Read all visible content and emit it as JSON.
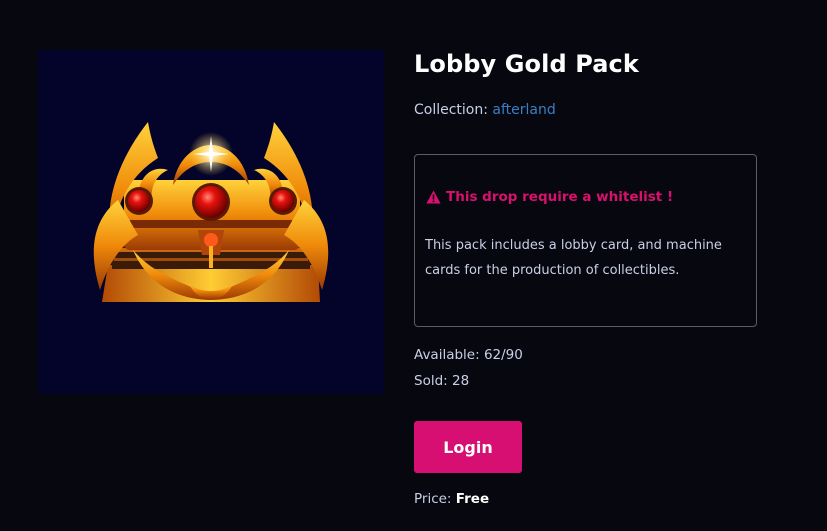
{
  "product": {
    "title": "Lobby Gold Pack",
    "image_alt": "golden treasure chest with red gems",
    "collection_label": "Collection:",
    "collection_name": "afterland"
  },
  "notice": {
    "warning_text": "This drop require a whitelist !",
    "warning_icon": "warning-triangle-icon",
    "description": "This pack includes a lobby card, and machine cards for the production of collectibles."
  },
  "stats": {
    "available_label": "Available:",
    "available_value": "62/90",
    "sold_label": "Sold:",
    "sold_value": "28"
  },
  "actions": {
    "login_label": "Login"
  },
  "pricing": {
    "label": "Price:",
    "value": "Free"
  },
  "colors": {
    "background": "#07070f",
    "accent": "#d80f72",
    "link": "#3a7fc4",
    "image_bg": "#04042b"
  }
}
